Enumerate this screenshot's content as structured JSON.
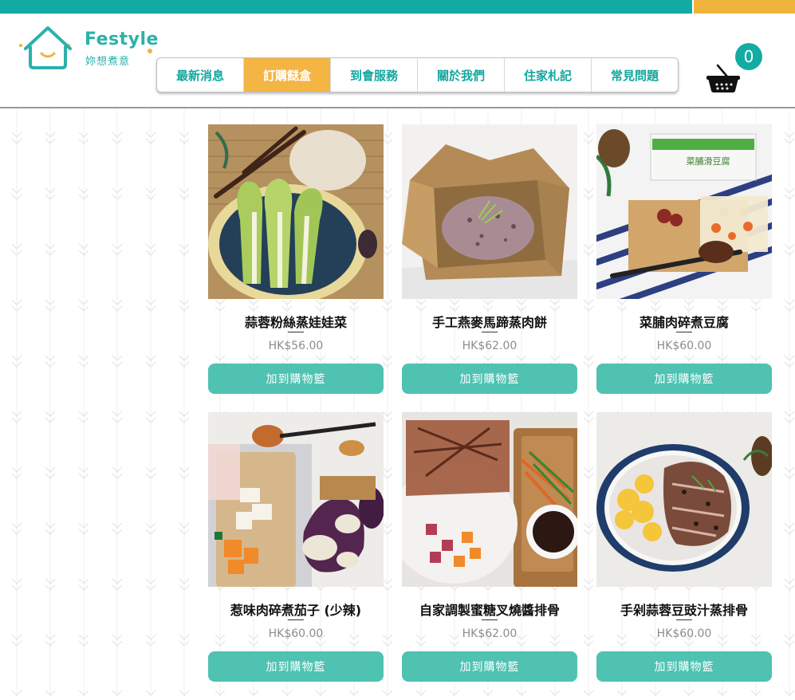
{
  "brand": {
    "name_en": "Festyle",
    "name_zh": "妳想煮意"
  },
  "nav": {
    "items": [
      {
        "label": "最新消息"
      },
      {
        "label": "訂購餸盒",
        "active": true
      },
      {
        "label": "到會服務"
      },
      {
        "label": "關於我們"
      },
      {
        "label": "住家札記"
      },
      {
        "label": "常見問題"
      }
    ]
  },
  "cart": {
    "count": "0",
    "icon": "basket-icon"
  },
  "colors": {
    "teal": "#12aaa3",
    "orange": "#f0b43c",
    "button": "#4fc2b1"
  },
  "products": [
    {
      "name": "蒜蓉粉絲蒸娃娃菜",
      "price": "HK$56.00",
      "button": "加到購物籃"
    },
    {
      "name": "手工燕麥馬蹄蒸肉餅",
      "price": "HK$62.00",
      "button": "加到購物籃"
    },
    {
      "name": "菜脯肉碎煮豆腐",
      "price": "HK$60.00",
      "button": "加到購物籃"
    },
    {
      "name": "惹味肉碎煮茄子 (少辣)",
      "price": "HK$60.00",
      "button": "加到購物籃"
    },
    {
      "name": "自家調製蜜糖叉燒醬排骨",
      "price": "HK$62.00",
      "button": "加到購物籃"
    },
    {
      "name": "手剁蒜蓉豆豉汁蒸排骨",
      "price": "HK$60.00",
      "button": "加到購物籃"
    }
  ],
  "packaging_label": "菜脯滑豆腐"
}
